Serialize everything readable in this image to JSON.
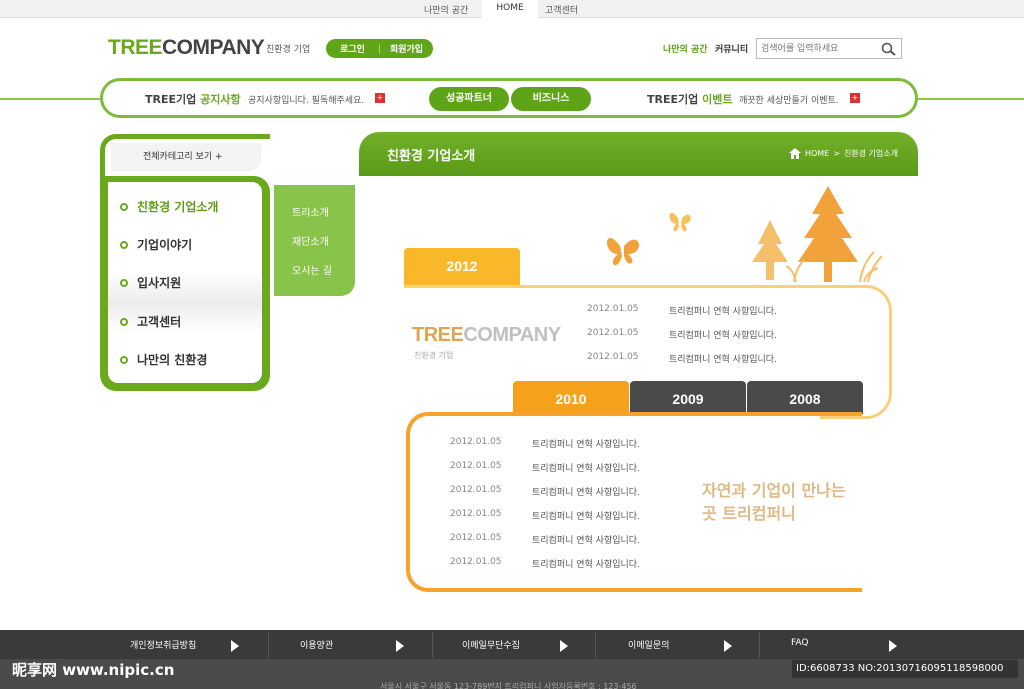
{
  "topbar": {
    "my_space": "나만의 공간",
    "home": "HOME",
    "customer": "고객센터"
  },
  "header": {
    "logo_tree": "TREE",
    "logo_company": "COMPANY",
    "logo_sub": "친환경 기업",
    "login": "로그인",
    "join": "회원가입",
    "my_space": "나만의 공간",
    "community": "커뮤니티",
    "search_placeholder": "검색어를 입력하세요"
  },
  "notice": {
    "left_title_a": "TREE기업",
    "left_title_b": "공지사항",
    "left_text": "공지사항입니다. 필독해주세요.",
    "btn_partner": "성공파트너",
    "btn_business": "비즈니스",
    "right_title_a": "TREE기업",
    "right_title_b": "이벤트",
    "right_text": "깨끗한 세상만들기 이벤트."
  },
  "leftnav": {
    "all_categories": "전체카테고리 보기  +",
    "items": [
      "친환경 기업소개",
      "기업이야기",
      "입사지원",
      "고객센터",
      "나만의 친환경"
    ],
    "active_index": 0,
    "submenu": [
      "트리소개",
      "재단소개",
      "오시는 길"
    ]
  },
  "content": {
    "title": "친환경 기업소개",
    "breadcrumb_home": "HOME",
    "breadcrumb_current": "친환경 기업소개",
    "year_main": "2012",
    "company_logo_tree": "TREE",
    "company_logo_company": "COMPANY",
    "company_logo_sub": "친환경 기업",
    "news_2012": [
      {
        "date": "2012.01.05",
        "title": "트리컴퍼니 연혁 사항입니다."
      },
      {
        "date": "2012.01.05",
        "title": "트리컴퍼니 연혁 사항입니다."
      },
      {
        "date": "2012.01.05",
        "title": "트리컴퍼니 연혁 사항입니다."
      }
    ],
    "year_tabs": [
      "2010",
      "2009",
      "2008"
    ],
    "news_2010": [
      {
        "date": "2012.01.05",
        "title": "트리컴퍼니 연혁 사항입니다."
      },
      {
        "date": "2012.01.05",
        "title": "트리컴퍼니 연혁 사항입니다."
      },
      {
        "date": "2012.01.05",
        "title": "트리컴퍼니 연혁 사항입니다."
      },
      {
        "date": "2012.01.05",
        "title": "트리컴퍼니 연혁 사항입니다."
      },
      {
        "date": "2012.01.05",
        "title": "트리컴퍼니 연혁 사항입니다."
      },
      {
        "date": "2012.01.05",
        "title": "트리컴퍼니 연혁 사항입니다."
      }
    ],
    "slogan_line1": "자연과 기업이 만나는",
    "slogan_line2": "곳 트리컴퍼니"
  },
  "footer": {
    "links": [
      "개인정보취급방침",
      "이용양관",
      "이메일무단수집",
      "이메일문의",
      "FAQ"
    ],
    "address": "서울시 서울구 서울동 123-789번지 트리컴퍼니 사업자등록번호 : 123-456"
  },
  "watermark": {
    "site": "昵享网 www.nipic.cn",
    "id": "ID:6608733 NO:20130716095118598000"
  },
  "colors": {
    "green": "#6aa91b",
    "orange": "#f5a32a",
    "yellow": "#f8b82a",
    "dark_tab": "#4a4a4a"
  }
}
